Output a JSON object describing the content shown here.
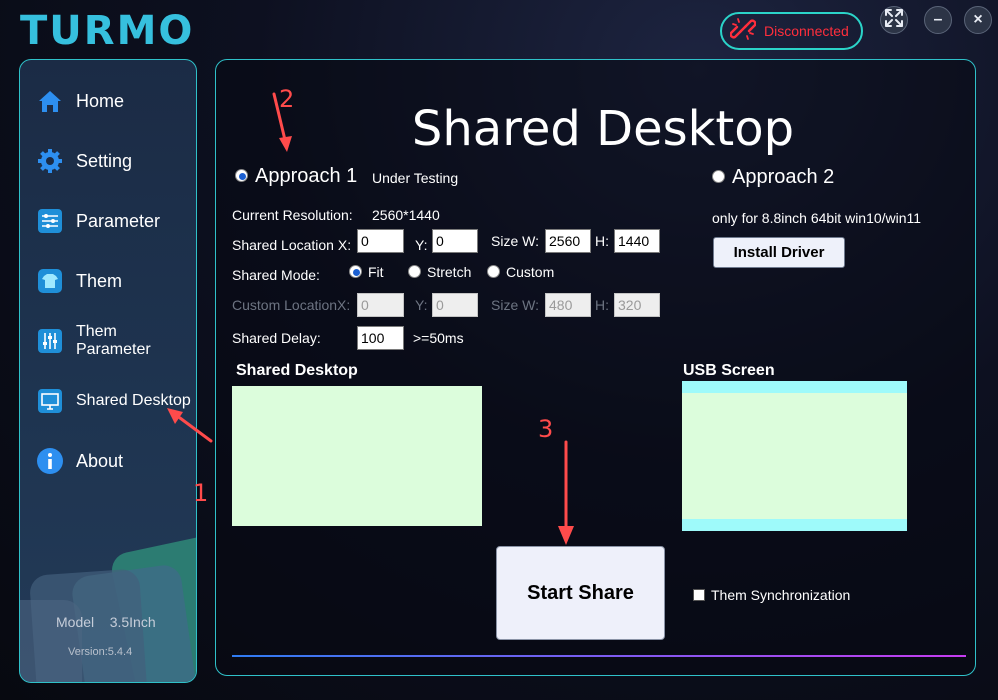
{
  "app": {
    "logo": "TURMO"
  },
  "header": {
    "connection_status": "Disconnected",
    "window_buttons": {
      "fullscreen_icon": "expand-arrows-icon",
      "minimize_label": "–",
      "close_label": "×"
    }
  },
  "sidebar": {
    "items": [
      {
        "label": "Home",
        "icon": "home-icon"
      },
      {
        "label": "Setting",
        "icon": "gear-icon"
      },
      {
        "label": "Parameter",
        "icon": "sliders-icon"
      },
      {
        "label": "Them",
        "icon": "shirt-icon"
      },
      {
        "label": "Them Parameter",
        "icon": "equalizer-icon"
      },
      {
        "label": "Shared Desktop",
        "icon": "monitor-icon"
      },
      {
        "label": "About",
        "icon": "info-icon"
      }
    ],
    "model_label": "Model",
    "model_value": "3.5Inch",
    "version": "Version:5.4.4"
  },
  "main": {
    "title": "Shared Desktop",
    "approach1": {
      "label": "Approach 1",
      "note": "Under Testing",
      "current_resolution_label": "Current Resolution:",
      "current_resolution_value": "2560*1440",
      "shared_location_label": "Shared Location X:",
      "location_x": "0",
      "y_label": "Y:",
      "location_y": "0",
      "size_w_label": "Size W:",
      "size_w": "2560",
      "h_label": "H:",
      "size_h": "1440",
      "shared_mode_label": "Shared Mode:",
      "mode_fit": "Fit",
      "mode_stretch": "Stretch",
      "mode_custom": "Custom",
      "custom_location_label": "Custom LocationX:",
      "custom_x": "0",
      "custom_y": "0",
      "custom_w": "480",
      "custom_h": "320",
      "shared_delay_label": "Shared Delay:",
      "shared_delay": "100",
      "delay_hint": ">=50ms"
    },
    "approach2": {
      "label": "Approach 2",
      "note": "only for 8.8inch 64bit win10/win11",
      "install_driver": "Install Driver"
    },
    "preview_left_label": "Shared Desktop",
    "preview_right_label": "USB Screen",
    "start_share": "Start Share",
    "sync_label": "Them Synchronization"
  },
  "annotations": {
    "step1": "1",
    "step2": "2",
    "step3": "3"
  },
  "colors": {
    "accent": "#2fc1c9",
    "disconnected": "#ff2e3c",
    "logo": "#36c0de",
    "preview": "#dcfddc",
    "annotation": "#ff4b4b"
  }
}
